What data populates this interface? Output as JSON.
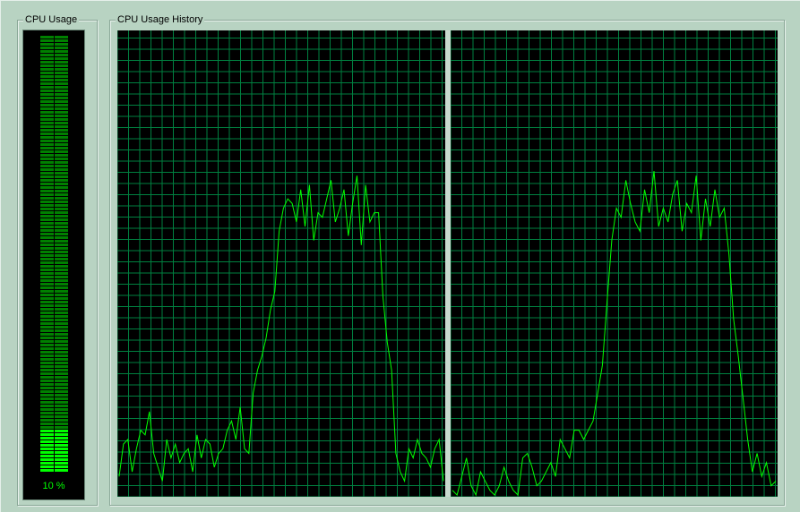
{
  "panels": {
    "usage_label": "CPU Usage",
    "history_label": "CPU Usage History"
  },
  "meter": {
    "value_text": "10 %",
    "fraction": 0.1,
    "lit_color": "#00ff00",
    "dim_color": "#008000"
  },
  "colors": {
    "background": "#b8d3c2",
    "graph_bg": "#000000",
    "grid": "#008040",
    "trace": "#00ff00"
  },
  "history": {
    "y_range": [
      0,
      100
    ],
    "cpu0": [
      4,
      11,
      12,
      5,
      10,
      14,
      13,
      18,
      9,
      6,
      3,
      12,
      8,
      11,
      7,
      9,
      10,
      5,
      13,
      8,
      12,
      11,
      6,
      9,
      10,
      14,
      16,
      12,
      19,
      10,
      9,
      22,
      27,
      30,
      34,
      40,
      44,
      57,
      62,
      64,
      63,
      59,
      66,
      58,
      67,
      55,
      61,
      60,
      64,
      68,
      59,
      62,
      66,
      56,
      63,
      69,
      54,
      67,
      59,
      61,
      61,
      43,
      33,
      27,
      9,
      5,
      3,
      10,
      8,
      12,
      9,
      8,
      6,
      10,
      12,
      3
    ],
    "cpu1": [
      1,
      0,
      4,
      8,
      2,
      0,
      5,
      3,
      1,
      0,
      2,
      6,
      3,
      1,
      0,
      8,
      9,
      6,
      2,
      3,
      5,
      7,
      4,
      12,
      10,
      8,
      14,
      14,
      12,
      14,
      16,
      22,
      28,
      42,
      55,
      62,
      60,
      68,
      63,
      59,
      57,
      66,
      61,
      70,
      58,
      62,
      59,
      65,
      68,
      57,
      63,
      61,
      69,
      55,
      64,
      58,
      66,
      60,
      62,
      52,
      38,
      30,
      21,
      12,
      5,
      9,
      4,
      7,
      2,
      3
    ]
  }
}
